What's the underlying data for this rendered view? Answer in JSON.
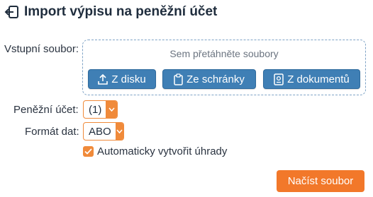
{
  "header": {
    "title": "Import výpisu na peněžní účet",
    "icon": "import-arrow-icon"
  },
  "form": {
    "file_label": "Vstupní soubor:",
    "dropzone_text": "Sem přetáhněte soubory",
    "buttons": [
      {
        "label": "Z disku",
        "icon": "upload-icon"
      },
      {
        "label": "Ze schránky",
        "icon": "clipboard-icon"
      },
      {
        "label": "Z dokumentů",
        "icon": "document-icon"
      }
    ],
    "account_label": "Peněžní účet:",
    "account_value": "(1)",
    "format_label": "Formát dat:",
    "format_value": "ABO",
    "auto_payments_label": "Automaticky vytvořit úhrady",
    "auto_payments_checked": true,
    "submit_label": "Načíst soubor"
  },
  "colors": {
    "accent_orange": "#f08a3a",
    "button_blue": "#3f7fb5",
    "submit_orange": "#f2782a"
  }
}
